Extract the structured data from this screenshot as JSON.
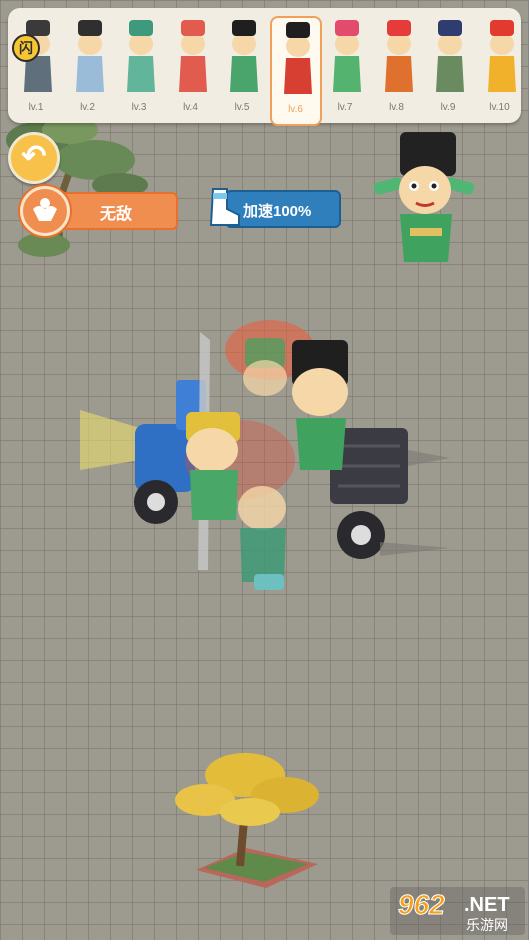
{
  "level_bar": {
    "lock_badge": "闪",
    "selected_index": 5,
    "levels": [
      {
        "label": "lv.1",
        "robe": "#5f6f7c",
        "hat": "#3a3a3a"
      },
      {
        "label": "lv.2",
        "robe": "#9bbcd9",
        "hat": "#2f2f2f"
      },
      {
        "label": "lv.3",
        "robe": "#62b59a",
        "hat": "#3e9a7c"
      },
      {
        "label": "lv.4",
        "robe": "#e25b4f",
        "hat": "#e25b4f"
      },
      {
        "label": "lv.5",
        "robe": "#4aa56c",
        "hat": "#1f1f1f"
      },
      {
        "label": "lv.6",
        "robe": "#d83f33",
        "hat": "#1f1f1f"
      },
      {
        "label": "lv.7",
        "robe": "#53b36f",
        "hat": "#e34b6e"
      },
      {
        "label": "lv.8",
        "robe": "#e0702e",
        "hat": "#e53b3b"
      },
      {
        "label": "lv.9",
        "robe": "#6a8a5f",
        "hat": "#2e3c70"
      },
      {
        "label": "lv.10",
        "robe": "#f2b12a",
        "hat": "#e23a2e"
      }
    ]
  },
  "buttons": {
    "back_icon": "↶",
    "invincible_label": "无敌",
    "speed_label": "加速100%"
  },
  "colors": {
    "accent_orange": "#f08e4f",
    "accent_blue": "#2f7fbd",
    "selection": "#f0a05a"
  },
  "watermark": {
    "number": "962",
    "net": ".NET",
    "sub": "乐游网"
  }
}
